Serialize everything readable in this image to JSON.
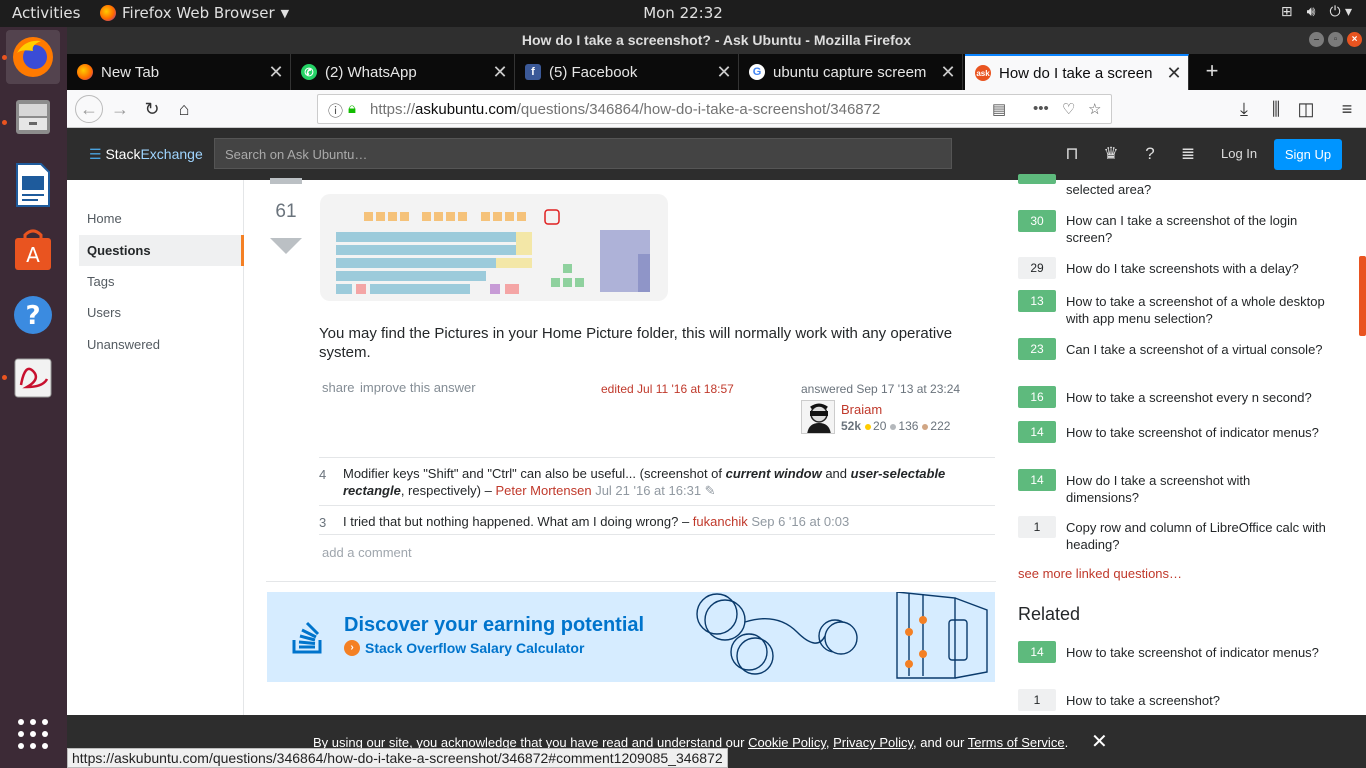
{
  "system": {
    "activities": "Activities",
    "app_name": "Firefox Web Browser",
    "clock": "Mon 22:32"
  },
  "window": {
    "title": "How do I take a screenshot? - Ask Ubuntu - Mozilla Firefox"
  },
  "tabs": [
    {
      "label": "New Tab",
      "favicon": "firefox-icon",
      "active": false
    },
    {
      "label": "(2) WhatsApp",
      "favicon": "whatsapp-icon",
      "active": false
    },
    {
      "label": "(5) Facebook",
      "favicon": "facebook-icon",
      "active": false
    },
    {
      "label": "ubuntu capture screem -",
      "favicon": "google-icon",
      "active": false
    },
    {
      "label": "How do I take a screensh",
      "favicon": "askubuntu-icon",
      "active": true
    }
  ],
  "url": {
    "prefix": "https://",
    "domain": "askubuntu.com",
    "path": "/questions/346864/how-do-i-take-a-screenshot/346872"
  },
  "header": {
    "logo_a": "Stack",
    "logo_b": "Exchange",
    "search_placeholder": "Search on Ask Ubuntu…",
    "login": "Log In",
    "signup": "Sign Up"
  },
  "leftnav": {
    "items": [
      "Home",
      "Questions",
      "Tags",
      "Users",
      "Unanswered"
    ]
  },
  "answer": {
    "score": "61",
    "body": "You may find the Pictures in your Home Picture folder, this will normally work with any operative system.",
    "share": "share",
    "improve": "improve this answer",
    "edited": "edited Jul 11 '16 at 18:57",
    "answered": "answered Sep 17 '13 at 23:24",
    "user": "Braiam",
    "rep": "52k",
    "gold": "20",
    "silver": "136",
    "bronze": "222"
  },
  "comments": [
    {
      "score": "4",
      "text_a": "Modifier keys \"Shift\" and \"Ctrl\" can also be useful... (screenshot of ",
      "em_a": "current window",
      "text_b": " and ",
      "em_b": "user-selectable rectangle",
      "text_c": ", respectively) – ",
      "user": "Peter Mortensen",
      "date": "Jul 21 '16 at 16:31"
    },
    {
      "score": "3",
      "text_a": "I tried that but nothing happened. What am I doing wrong? – ",
      "user": "fukanchik",
      "date": "Sep 6 '16 at 0:03"
    }
  ],
  "add_comment": "add a comment",
  "ad": {
    "headline": "Discover your earning potential",
    "sub": "Stack Overflow Salary Calculator"
  },
  "sidebar": {
    "linked": [
      {
        "score": "",
        "title": "selected area?",
        "accepted": true
      },
      {
        "score": "30",
        "title": "How can I take a screenshot of the login screen?",
        "accepted": true
      },
      {
        "score": "29",
        "title": "How do I take screenshots with a delay?",
        "accepted": false
      },
      {
        "score": "13",
        "title": "How to take a screenshot of a whole desktop with app menu selection?",
        "accepted": true
      },
      {
        "score": "23",
        "title": "Can I take a screenshot of a virtual console?",
        "accepted": true
      },
      {
        "score": "16",
        "title": "How to take a screenshot every n second?",
        "accepted": true
      },
      {
        "score": "14",
        "title": "How to take screenshot of indicator menus?",
        "accepted": true
      },
      {
        "score": "14",
        "title": "How do I take a screenshot with dimensions?",
        "accepted": true
      },
      {
        "score": "1",
        "title": "Copy row and column of LibreOffice calc with heading?",
        "accepted": false
      }
    ],
    "see_more": "see more linked questions…",
    "related_title": "Related",
    "related": [
      {
        "score": "14",
        "title": "How to take screenshot of indicator menus?",
        "accepted": true
      },
      {
        "score": "1",
        "title": "How to take a screenshot?",
        "accepted": false
      }
    ]
  },
  "cookie": {
    "text_a": "By using our site, you acknowledge that you have read and understand our ",
    "link_a": "Cookie Policy",
    "sep_a": ", ",
    "link_b": "Privacy Policy",
    "sep_b": ", and our ",
    "link_c": "Terms of Service",
    "end": ".",
    "close": "✕"
  },
  "status_url": "https://askubuntu.com/questions/346864/how-do-i-take-a-screenshot/346872#comment1209085_346872",
  "colors": {
    "accent": "#0095ff",
    "ubuntu_orange": "#e95420",
    "accepted_green": "#5eba7d",
    "so_orange": "#f48024"
  }
}
